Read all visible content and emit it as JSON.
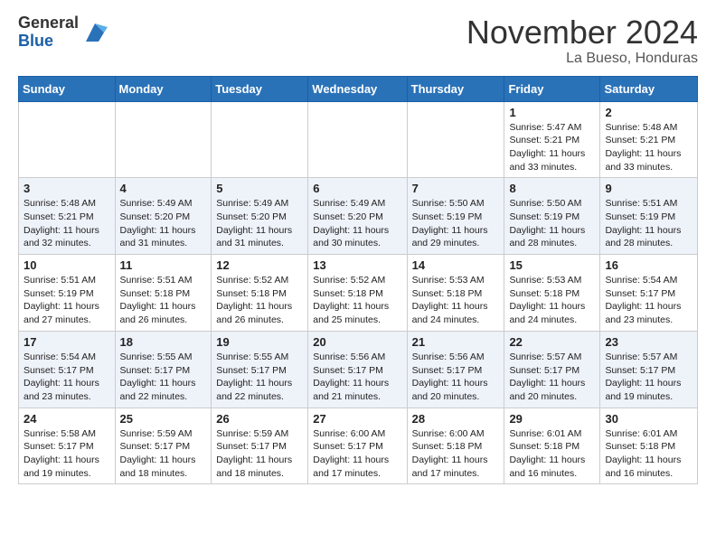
{
  "logo": {
    "general": "General",
    "blue": "Blue"
  },
  "header": {
    "month": "November 2024",
    "location": "La Bueso, Honduras"
  },
  "weekdays": [
    "Sunday",
    "Monday",
    "Tuesday",
    "Wednesday",
    "Thursday",
    "Friday",
    "Saturday"
  ],
  "weeks": [
    [
      {
        "day": "",
        "info": ""
      },
      {
        "day": "",
        "info": ""
      },
      {
        "day": "",
        "info": ""
      },
      {
        "day": "",
        "info": ""
      },
      {
        "day": "",
        "info": ""
      },
      {
        "day": "1",
        "info": "Sunrise: 5:47 AM\nSunset: 5:21 PM\nDaylight: 11 hours\nand 33 minutes."
      },
      {
        "day": "2",
        "info": "Sunrise: 5:48 AM\nSunset: 5:21 PM\nDaylight: 11 hours\nand 33 minutes."
      }
    ],
    [
      {
        "day": "3",
        "info": "Sunrise: 5:48 AM\nSunset: 5:21 PM\nDaylight: 11 hours\nand 32 minutes."
      },
      {
        "day": "4",
        "info": "Sunrise: 5:49 AM\nSunset: 5:20 PM\nDaylight: 11 hours\nand 31 minutes."
      },
      {
        "day": "5",
        "info": "Sunrise: 5:49 AM\nSunset: 5:20 PM\nDaylight: 11 hours\nand 31 minutes."
      },
      {
        "day": "6",
        "info": "Sunrise: 5:49 AM\nSunset: 5:20 PM\nDaylight: 11 hours\nand 30 minutes."
      },
      {
        "day": "7",
        "info": "Sunrise: 5:50 AM\nSunset: 5:19 PM\nDaylight: 11 hours\nand 29 minutes."
      },
      {
        "day": "8",
        "info": "Sunrise: 5:50 AM\nSunset: 5:19 PM\nDaylight: 11 hours\nand 28 minutes."
      },
      {
        "day": "9",
        "info": "Sunrise: 5:51 AM\nSunset: 5:19 PM\nDaylight: 11 hours\nand 28 minutes."
      }
    ],
    [
      {
        "day": "10",
        "info": "Sunrise: 5:51 AM\nSunset: 5:19 PM\nDaylight: 11 hours\nand 27 minutes."
      },
      {
        "day": "11",
        "info": "Sunrise: 5:51 AM\nSunset: 5:18 PM\nDaylight: 11 hours\nand 26 minutes."
      },
      {
        "day": "12",
        "info": "Sunrise: 5:52 AM\nSunset: 5:18 PM\nDaylight: 11 hours\nand 26 minutes."
      },
      {
        "day": "13",
        "info": "Sunrise: 5:52 AM\nSunset: 5:18 PM\nDaylight: 11 hours\nand 25 minutes."
      },
      {
        "day": "14",
        "info": "Sunrise: 5:53 AM\nSunset: 5:18 PM\nDaylight: 11 hours\nand 24 minutes."
      },
      {
        "day": "15",
        "info": "Sunrise: 5:53 AM\nSunset: 5:18 PM\nDaylight: 11 hours\nand 24 minutes."
      },
      {
        "day": "16",
        "info": "Sunrise: 5:54 AM\nSunset: 5:17 PM\nDaylight: 11 hours\nand 23 minutes."
      }
    ],
    [
      {
        "day": "17",
        "info": "Sunrise: 5:54 AM\nSunset: 5:17 PM\nDaylight: 11 hours\nand 23 minutes."
      },
      {
        "day": "18",
        "info": "Sunrise: 5:55 AM\nSunset: 5:17 PM\nDaylight: 11 hours\nand 22 minutes."
      },
      {
        "day": "19",
        "info": "Sunrise: 5:55 AM\nSunset: 5:17 PM\nDaylight: 11 hours\nand 22 minutes."
      },
      {
        "day": "20",
        "info": "Sunrise: 5:56 AM\nSunset: 5:17 PM\nDaylight: 11 hours\nand 21 minutes."
      },
      {
        "day": "21",
        "info": "Sunrise: 5:56 AM\nSunset: 5:17 PM\nDaylight: 11 hours\nand 20 minutes."
      },
      {
        "day": "22",
        "info": "Sunrise: 5:57 AM\nSunset: 5:17 PM\nDaylight: 11 hours\nand 20 minutes."
      },
      {
        "day": "23",
        "info": "Sunrise: 5:57 AM\nSunset: 5:17 PM\nDaylight: 11 hours\nand 19 minutes."
      }
    ],
    [
      {
        "day": "24",
        "info": "Sunrise: 5:58 AM\nSunset: 5:17 PM\nDaylight: 11 hours\nand 19 minutes."
      },
      {
        "day": "25",
        "info": "Sunrise: 5:59 AM\nSunset: 5:17 PM\nDaylight: 11 hours\nand 18 minutes."
      },
      {
        "day": "26",
        "info": "Sunrise: 5:59 AM\nSunset: 5:17 PM\nDaylight: 11 hours\nand 18 minutes."
      },
      {
        "day": "27",
        "info": "Sunrise: 6:00 AM\nSunset: 5:17 PM\nDaylight: 11 hours\nand 17 minutes."
      },
      {
        "day": "28",
        "info": "Sunrise: 6:00 AM\nSunset: 5:18 PM\nDaylight: 11 hours\nand 17 minutes."
      },
      {
        "day": "29",
        "info": "Sunrise: 6:01 AM\nSunset: 5:18 PM\nDaylight: 11 hours\nand 16 minutes."
      },
      {
        "day": "30",
        "info": "Sunrise: 6:01 AM\nSunset: 5:18 PM\nDaylight: 11 hours\nand 16 minutes."
      }
    ]
  ]
}
